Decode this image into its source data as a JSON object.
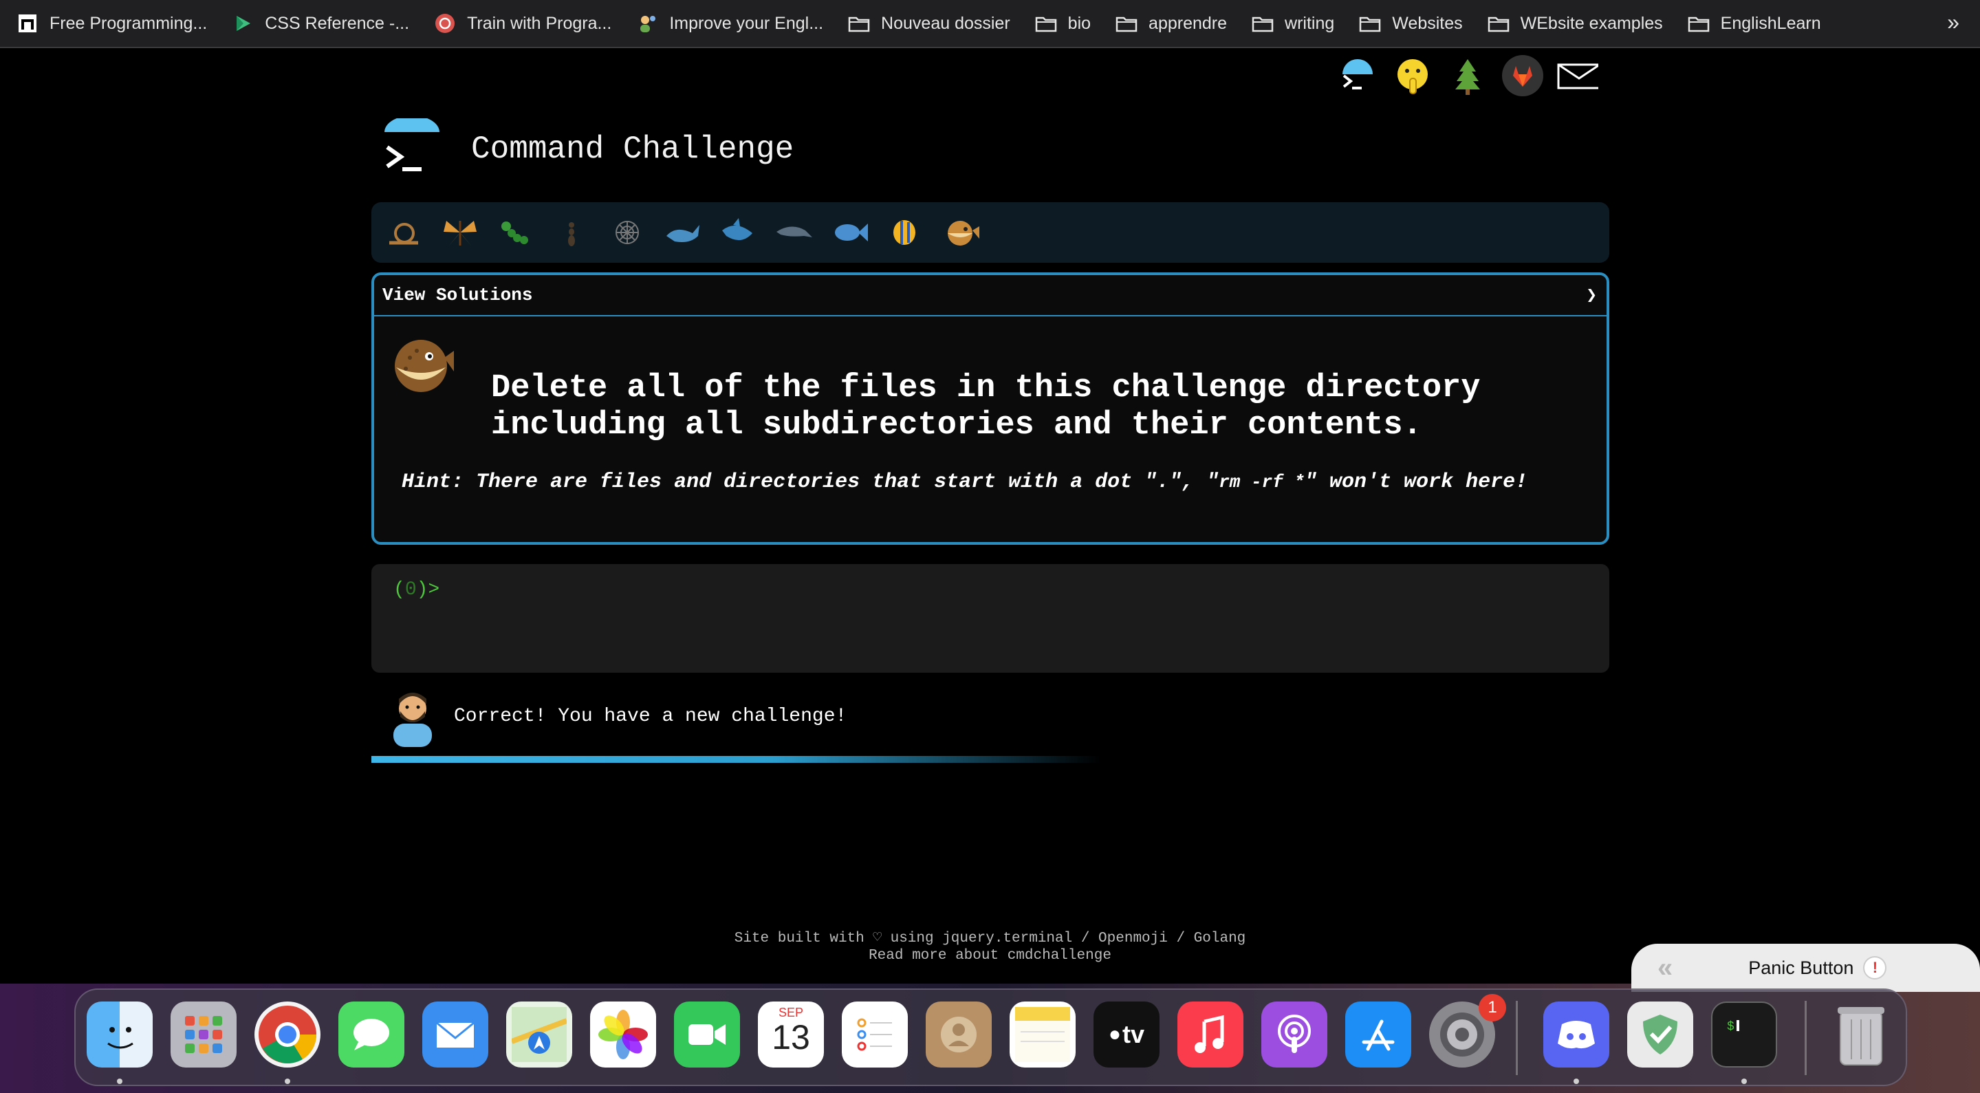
{
  "bookmarks": {
    "items": [
      {
        "label": "Free Programming...",
        "icon": "freecodecamp-icon"
      },
      {
        "label": "CSS Reference -...",
        "icon": "css-reference-icon"
      },
      {
        "label": "Train with Progra...",
        "icon": "openai-icon"
      },
      {
        "label": "Improve your Engl...",
        "icon": "person-icon"
      },
      {
        "label": "Nouveau dossier",
        "icon": "folder-icon"
      },
      {
        "label": "bio",
        "icon": "folder-icon"
      },
      {
        "label": "apprendre",
        "icon": "folder-icon"
      },
      {
        "label": "writing",
        "icon": "folder-icon"
      },
      {
        "label": "Websites",
        "icon": "folder-icon"
      },
      {
        "label": "WEbsite examples",
        "icon": "folder-icon"
      },
      {
        "label": "EnglishLearn",
        "icon": "folder-icon"
      }
    ],
    "more": "»"
  },
  "site": {
    "title": "Command Challenge",
    "top_icons": [
      "terminal-icon",
      "shushing-face-icon",
      "tree-icon",
      "gitlab-icon",
      "mail-icon"
    ],
    "animals": [
      "snail-icon",
      "butterfly-icon",
      "caterpillar-icon",
      "ant-icon",
      "spider-web-icon",
      "whale-icon",
      "shark-icon",
      "dolphin-icon",
      "fish-icon",
      "tropical-fish-icon",
      "blowfish-icon"
    ]
  },
  "challenge": {
    "solutions_label": "View Solutions",
    "chevron": "❯",
    "task": "Delete all of the files in this challenge directory including all subdirectories and their contents.",
    "hint_prefix": "Hint: There are files and directories that start with a dot \".\", \"",
    "hint_code": "rm -rf *",
    "hint_suffix": "\" won't work here!"
  },
  "terminal": {
    "prompt_open": "(",
    "prompt_count": "0",
    "prompt_close": ")>"
  },
  "feedback": {
    "message": "Correct! You have a new challenge!"
  },
  "footer": {
    "line1": "Site built with ♡ using jquery.terminal / Openmoji / Golang",
    "line2": "Read more about cmdchallenge"
  },
  "panic": {
    "chevron": "«",
    "label": "Panic Button",
    "alert": "!"
  },
  "dock": {
    "apps": [
      "Finder",
      "Launchpad",
      "Chrome",
      "Messages",
      "Mail",
      "Maps",
      "Photos",
      "FaceTime",
      "Calendar",
      "Reminders",
      "Contacts",
      "Notes",
      "TV",
      "Music",
      "Podcasts",
      "App Store",
      "System Settings",
      "Discord",
      "AdGuard",
      "Terminal",
      "Trash"
    ],
    "calendar_month": "SEP",
    "calendar_day": "13",
    "settings_badge": "1",
    "tv_label": "tv"
  }
}
